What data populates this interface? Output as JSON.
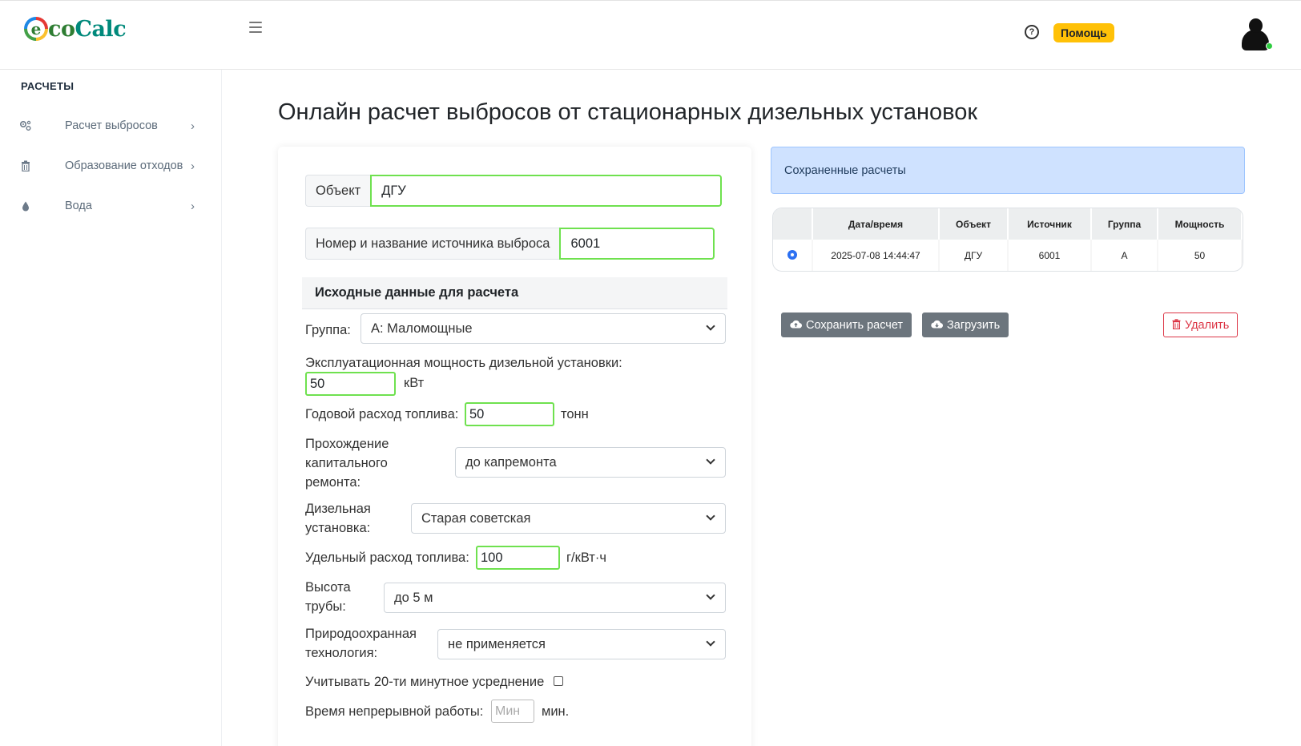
{
  "header": {
    "logo_first": "e",
    "logo_rest_green": "co",
    "logo_rest_teal": "Calc",
    "help_icon": "question-circle-icon",
    "help_label": "Помощь"
  },
  "sidebar": {
    "title": "РАСЧЕТЫ",
    "items": [
      {
        "icon": "gears-icon",
        "label": "Расчет выбросов"
      },
      {
        "icon": "trash-icon",
        "label": "Образование отходов"
      },
      {
        "icon": "droplet-icon",
        "label": "Вода"
      }
    ]
  },
  "main": {
    "title": "Онлайн расчет выбросов от стационарных дизельных установок",
    "object_label": "Объект",
    "object_value": "ДГУ",
    "source_label": "Номер и название источника выброса",
    "source_value": "6001",
    "section_title": "Исходные данные для расчета",
    "group_label": "Группа:",
    "group_value": "А: Маломощные",
    "power_label": "Эксплуатационная мощность дизельной установки:",
    "power_value": "50",
    "power_unit": "кВт",
    "fuel_label": "Годовой расход топлива:",
    "fuel_value": "50",
    "fuel_unit": "тонн",
    "repair_label_1": "Прохождение",
    "repair_label_2": "капитального",
    "repair_label_3": "ремонта:",
    "repair_value": "до капремонта",
    "diesel_label_1": "Дизельная",
    "diesel_label_2": "установка:",
    "diesel_value": "Старая советская",
    "specific_label": "Удельный расход топлива:",
    "specific_value": "100",
    "specific_unit": "г/кВт·ч",
    "height_label_1": "Высота",
    "height_label_2": "трубы:",
    "height_value": "до 5 м",
    "tech_label_1": "Природоохранная",
    "tech_label_2": "технология:",
    "tech_value": "не применяется",
    "avg_label": "Учитывать 20-ти минутное усреднение",
    "avg_checked": false,
    "time_label": "Время непрерывной работы:",
    "time_placeholder": "Мин",
    "time_unit": "мин."
  },
  "saved": {
    "title": "Сохраненные расчеты",
    "columns": [
      "",
      "Дата/время",
      "Объект",
      "Источник",
      "Группа",
      "Мощность"
    ],
    "rows": [
      {
        "datetime": "2025-07-08 14:44:47",
        "object": "ДГУ",
        "source": "6001",
        "group": "А",
        "power": "50"
      }
    ],
    "save_label": "Сохранить расчет",
    "load_label": "Загрузить",
    "delete_label": "Удалить"
  },
  "colors": {
    "accent_green": "#6fe14f",
    "help_yellow": "#ffc107",
    "alert_blue": "#cfe2ff",
    "danger": "#dc3545",
    "secondary": "#6c757d"
  }
}
